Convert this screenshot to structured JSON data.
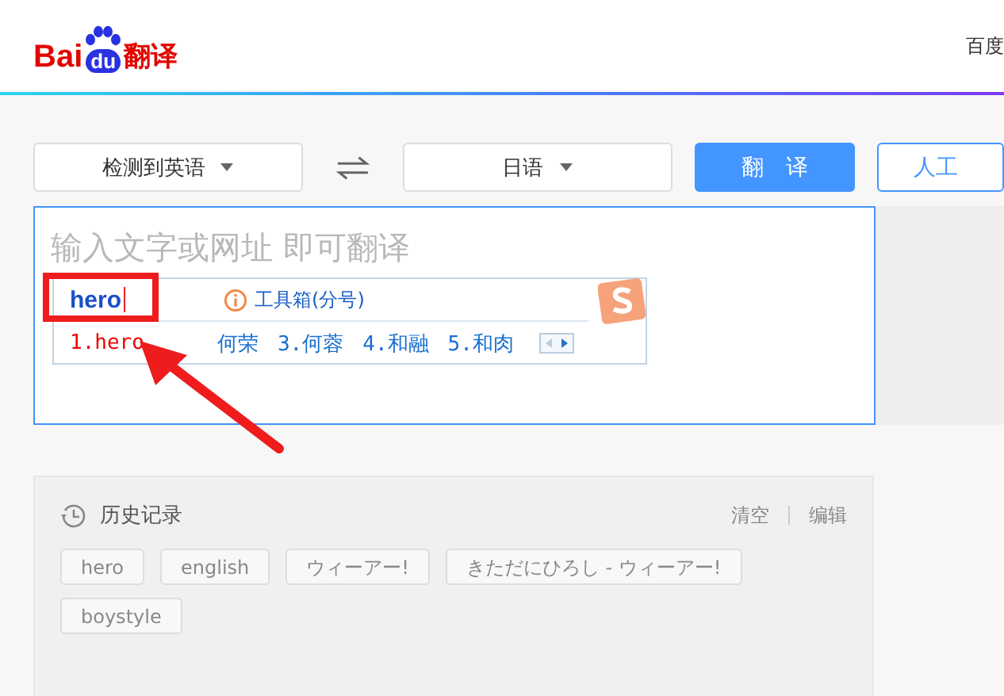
{
  "header": {
    "logo_text": "Bai",
    "logo_badge": "du",
    "logo_suffix": "翻译",
    "top_right_link": "百度"
  },
  "toolbar": {
    "source_language": "检测到英语",
    "target_language": "日语",
    "translate_button": "翻　译",
    "human_button": "人工"
  },
  "input": {
    "placeholder": "输入文字或网址 即可翻译"
  },
  "ime": {
    "composition": "hero",
    "toolbox": "工具箱(分号)",
    "candidates": [
      {
        "text": "1.hero",
        "selected": true
      },
      {
        "text": "何荣",
        "selected": false
      },
      {
        "text": "3.何蓉",
        "selected": false
      },
      {
        "text": "4.和融",
        "selected": false
      },
      {
        "text": "5.和肉",
        "selected": false
      }
    ]
  },
  "history": {
    "title": "历史记录",
    "clear": "清空",
    "edit": "编辑",
    "items": [
      "hero",
      "english",
      "ウィーアー!",
      "きただにひろし - ウィーアー!",
      "boystyle"
    ]
  }
}
